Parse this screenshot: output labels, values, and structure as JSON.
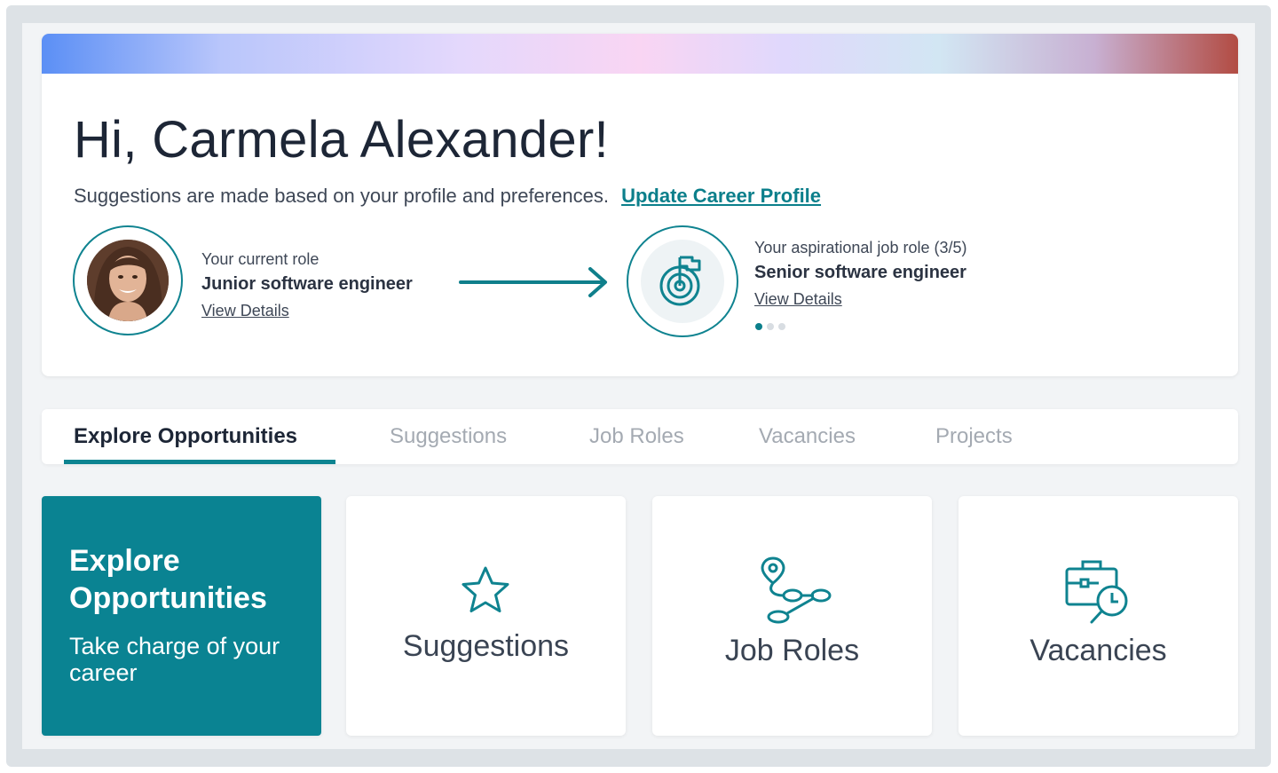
{
  "hero": {
    "greeting": "Hi, Carmela Alexander!",
    "subline": "Suggestions are made based on your profile and preferences.",
    "update_link": "Update Career Profile",
    "current_role": {
      "label": "Your current role",
      "title": "Junior software engineer",
      "link": "View Details"
    },
    "aspirational_role": {
      "label": "Your aspirational job role (3/5)",
      "title": "Senior software engineer",
      "link": "View Details"
    },
    "carousel": {
      "total_dots": 3,
      "active_index": 0
    }
  },
  "tabs": [
    {
      "label": "Explore Opportunities",
      "active": true
    },
    {
      "label": "Suggestions",
      "active": false
    },
    {
      "label": "Job Roles",
      "active": false
    },
    {
      "label": "Vacancies",
      "active": false
    },
    {
      "label": "Projects",
      "active": false
    }
  ],
  "cards": {
    "explore": {
      "title": "Explore Opportunities",
      "subtitle": "Take charge of your career"
    },
    "suggestions": {
      "label": "Suggestions",
      "icon": "star-icon"
    },
    "job_roles": {
      "label": "Job Roles",
      "icon": "career-path-icon"
    },
    "vacancies": {
      "label": "Vacancies",
      "icon": "briefcase-search-icon"
    }
  },
  "colors": {
    "accent": "#0b7f8b",
    "primary_card": "#0a8392",
    "text_dark": "#1d2636",
    "tab_inactive": "#a4aab2"
  }
}
